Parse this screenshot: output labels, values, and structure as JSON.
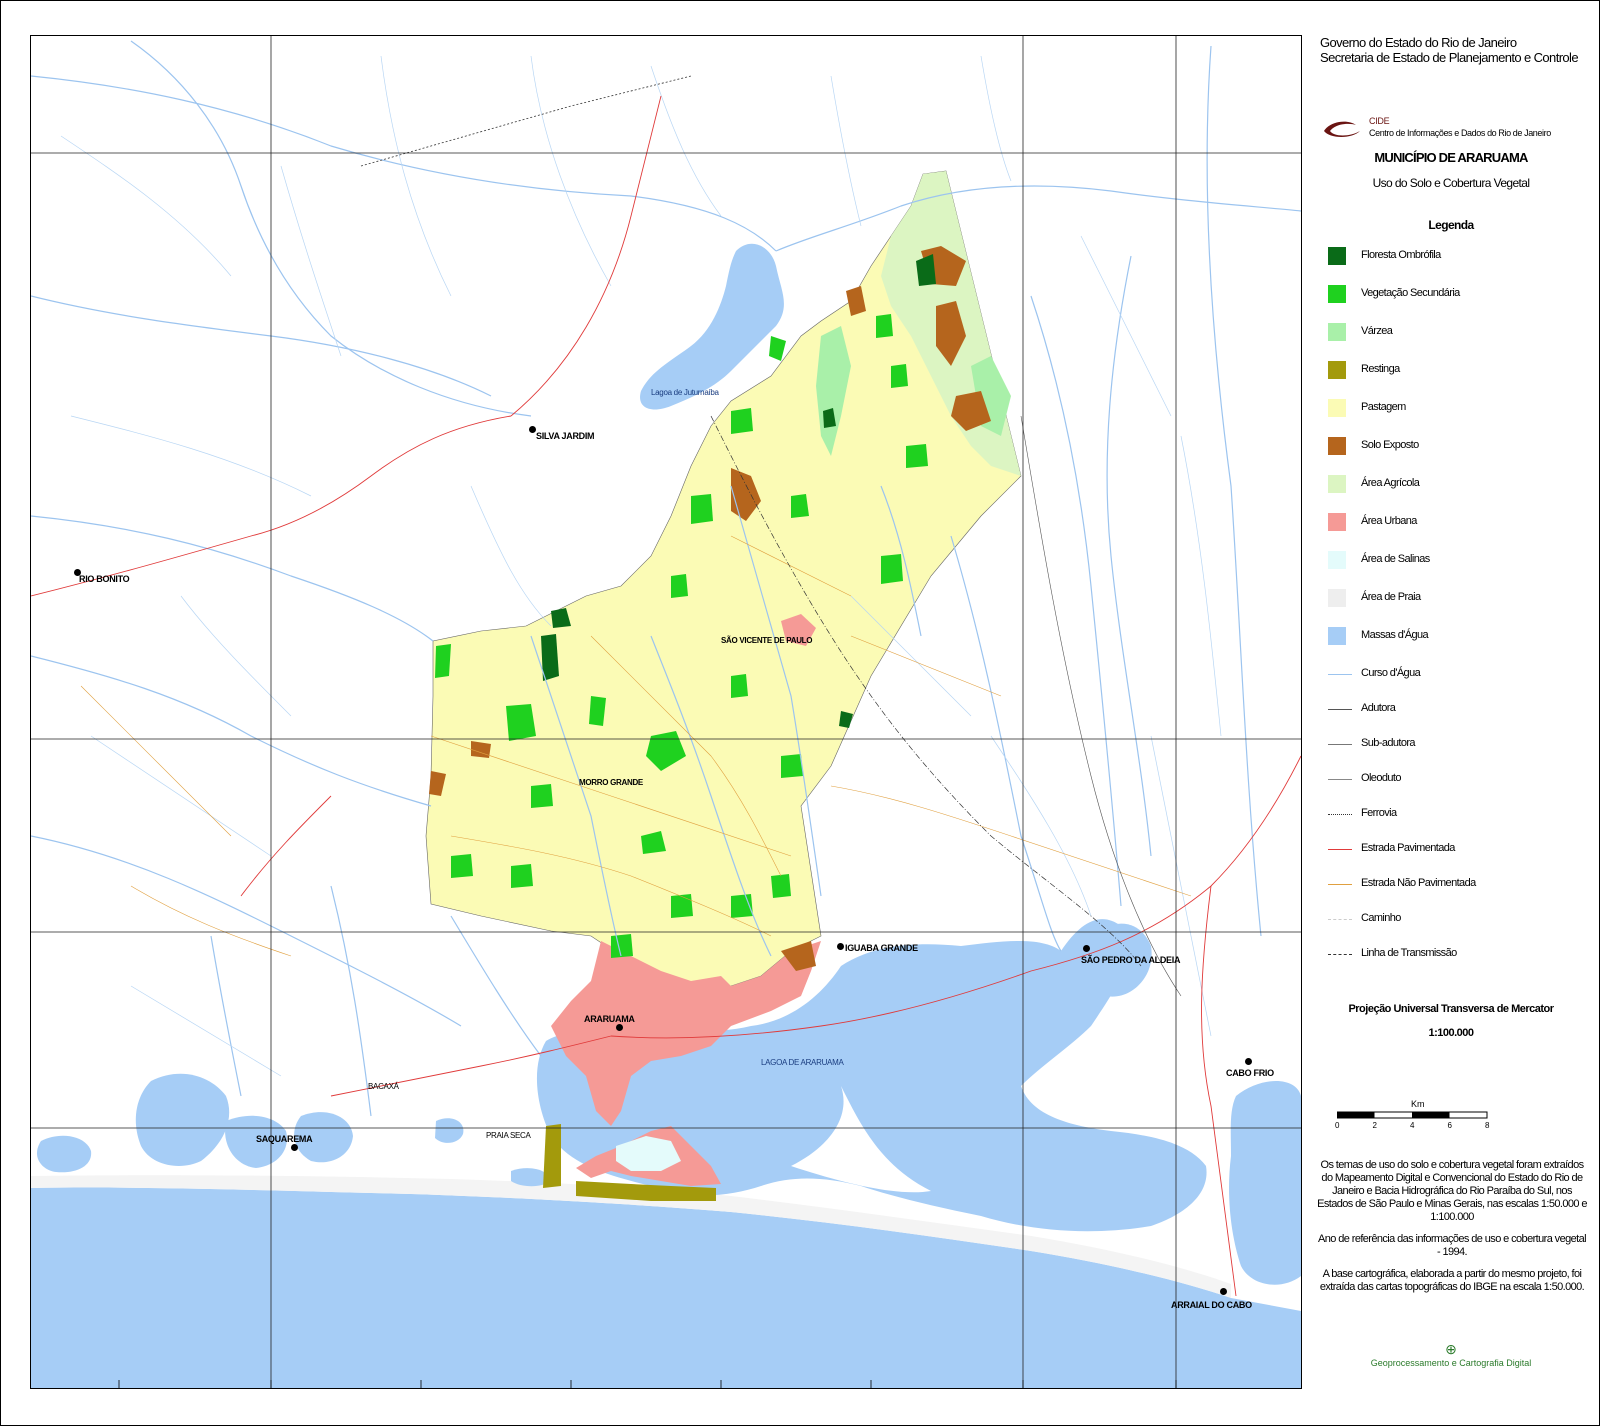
{
  "header": {
    "line1": "Governo do Estado do Rio de Janeiro",
    "line2": "Secretaria de Estado de Planejamento e Controle",
    "org_short": "CIDE",
    "org_full": "Centro de Informações e Dados do Rio de Janeiro"
  },
  "title": "MUNICÍPIO DE ARARUAMA",
  "subtitle": "Uso do Solo e Cobertura Vegetal",
  "legend": {
    "title": "Legenda",
    "areas": [
      {
        "label": "Floresta Ombrófila",
        "color": "#0a6b18"
      },
      {
        "label": "Vegetação Secundária",
        "color": "#1fd11f"
      },
      {
        "label": "Várzea",
        "color": "#a9f0a9"
      },
      {
        "label": "Restinga",
        "color": "#a39a0c"
      },
      {
        "label": "Pastagem",
        "color": "#fbfbb5"
      },
      {
        "label": "Solo Exposto",
        "color": "#b5651d"
      },
      {
        "label": "Área Agrícola",
        "color": "#dcf5c2"
      },
      {
        "label": "Área Urbana",
        "color": "#f59a96"
      },
      {
        "label": "Área de Salinas",
        "color": "#e4fbfb"
      },
      {
        "label": "Área de Praia",
        "color": "#eeeeee"
      },
      {
        "label": "Massas d'Água",
        "color": "#a6cdf6"
      }
    ],
    "lines": [
      {
        "label": "Curso d'Água",
        "color": "#9cc4ef",
        "style": "solid"
      },
      {
        "label": "Adutora",
        "color": "#555555",
        "style": "solid"
      },
      {
        "label": "Sub-adutora",
        "color": "#777777",
        "style": "solid"
      },
      {
        "label": "Oleoduto",
        "color": "#888888",
        "style": "solid"
      },
      {
        "label": "Ferrovia",
        "color": "#333333",
        "style": "dotted"
      },
      {
        "label": "Estrada Pavimentada",
        "color": "#e03a3a",
        "style": "solid"
      },
      {
        "label": "Estrada Não Pavimentada",
        "color": "#e0a040",
        "style": "solid"
      },
      {
        "label": "Caminho",
        "color": "#cccccc",
        "style": "dashed"
      },
      {
        "label": "Linha de Transmissão",
        "color": "#333333",
        "style": "dashdot"
      }
    ]
  },
  "projection": "Projeção Universal Transversa de Mercator",
  "scale": "1:100.000",
  "scalebar": {
    "unit": "Km",
    "ticks": [
      "0",
      "2",
      "4",
      "6",
      "8"
    ]
  },
  "notes": [
    "Os temas de uso do solo e cobertura vegetal foram extraídos do Mapeamento Digital e Convencional do Estado do Rio de Janeiro e Bacia Hidrográfica do Rio Paraíba do Sul, nos Estados de São Paulo e Minas Gerais, nas escalas 1:50.000 e 1:100.000",
    "Ano de referência das informações de uso e cobertura vegetal - 1994.",
    "A base cartográfica, elaborada a partir do mesmo projeto, foi extraída das cartas topográficas do IBGE na escala 1:50.000."
  ],
  "footer_logo": "Geoprocessamento e Cartografia Digital",
  "places": {
    "silva_jardim": "SILVA JARDIM",
    "rio_bonito": "RIO BONITO",
    "sao_vicente": "SÃO VICENTE DE PAULO",
    "morro_grande": "MORRO GRANDE",
    "araruama": "ARARUAMA",
    "iguaba_grande": "IGUABA GRANDE",
    "sao_pedro": "SÃO PEDRO DA ALDEIA",
    "cabo_frio": "CABO FRIO",
    "arraial": "ARRAIAL DO CABO",
    "saquarema": "SAQUAREMA",
    "lagoa_araruama": "LAGOA DE ARARUAMA",
    "lagoa_juturnaiba": "Lagoa de Juturnaíba",
    "bacaxa": "BACAXÁ",
    "praia_seca": "PRAIA SECA"
  },
  "colors": {
    "frame": "#000000",
    "ocean": "#a6cdf6",
    "river": "#9cc4ef",
    "grid": "#222222"
  }
}
